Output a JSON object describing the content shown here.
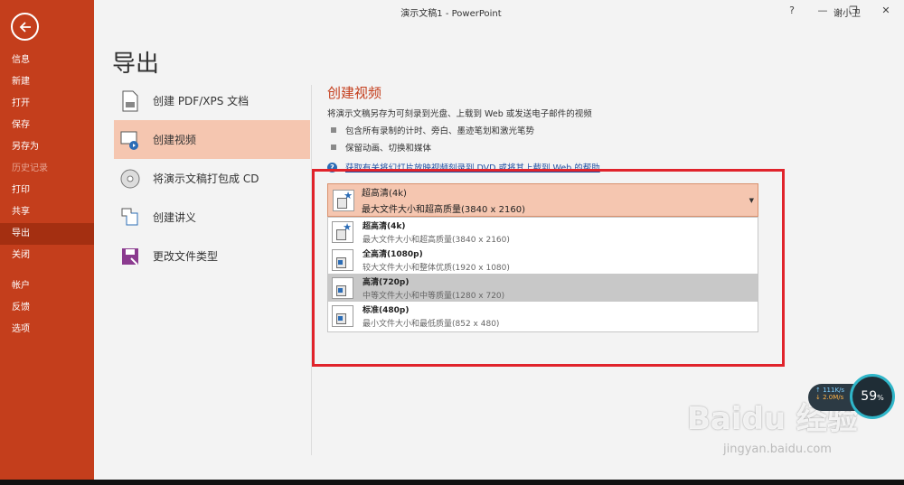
{
  "window": {
    "title": "演示文稿1  -  PowerPoint",
    "user": "谢小卫",
    "help": "?",
    "minimize": "—",
    "restore": "❐",
    "close": "✕"
  },
  "sidebar": {
    "items": [
      {
        "label": "信息"
      },
      {
        "label": "新建"
      },
      {
        "label": "打开"
      },
      {
        "label": "保存"
      },
      {
        "label": "另存为"
      },
      {
        "label": "历史记录"
      },
      {
        "label": "打印"
      },
      {
        "label": "共享"
      },
      {
        "label": "导出"
      },
      {
        "label": "关闭"
      },
      {
        "label": "帐户"
      },
      {
        "label": "反馈"
      },
      {
        "label": "选项"
      }
    ]
  },
  "page_title": "导出",
  "options": [
    {
      "label": "创建 PDF/XPS 文档"
    },
    {
      "label": "创建视频"
    },
    {
      "label": "将演示文稿打包成 CD"
    },
    {
      "label": "创建讲义"
    },
    {
      "label": "更改文件类型"
    }
  ],
  "detail": {
    "heading": "创建视频",
    "description": "将演示文稿另存为可刻录到光盘、上载到 Web 或发送电子邮件的视频",
    "bullets": [
      "包含所有录制的计时、旁白、墨迹笔划和激光笔势",
      "保留动画、切换和媒体"
    ],
    "help_link": "获取有关将幻灯片放映视频刻录到 DVD 或将其上载到 Web 的帮助"
  },
  "quality_dropdown": {
    "selected": {
      "title": "超高清(4k)",
      "subtitle": "最大文件大小和超高质量(3840 x 2160)"
    },
    "options": [
      {
        "title": "超高清(4k)",
        "subtitle": "最大文件大小和超高质量(3840 x 2160)"
      },
      {
        "title": "全高清(1080p)",
        "subtitle": "较大文件大小和整体优质(1920 x 1080)"
      },
      {
        "title": "高清(720p)",
        "subtitle": "中等文件大小和中等质量(1280 x 720)"
      },
      {
        "title": "标准(480p)",
        "subtitle": "最小文件大小和最低质量(852 x 480)"
      }
    ]
  },
  "network_widget": {
    "upload": "↑ 111K/s",
    "download": "↓ 2.0M/s",
    "percent": "59",
    "percent_unit": "%"
  },
  "watermark": {
    "brand": "Baidu 经验",
    "url": "jingyan.baidu.com"
  }
}
